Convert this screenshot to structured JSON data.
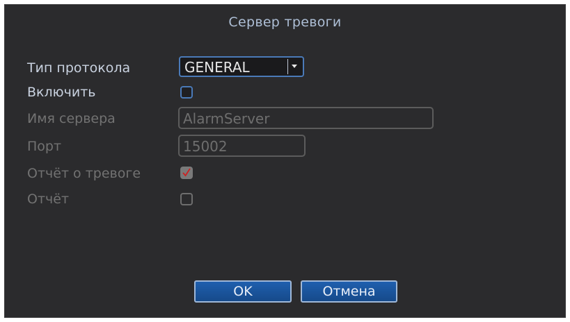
{
  "dialog": {
    "title": "Сервер тревоги"
  },
  "form": {
    "protocol_label": "Тип протокола",
    "protocol_value": "GENERAL",
    "enable_label": "Включить",
    "enable_checked": false,
    "server_name_label": "Имя сервера",
    "server_name_value": "AlarmServer",
    "port_label": "Порт",
    "port_value": "15002",
    "alarm_report_label": "Отчёт о тревоге",
    "alarm_report_checked": true,
    "report_label": "Отчёт",
    "report_checked": false
  },
  "buttons": {
    "ok_label": "OK",
    "cancel_label": "Отмена"
  },
  "colors": {
    "dialog_bg": "#2b2b2d",
    "title_text": "#aebfd6",
    "accent_border": "#4a7ab8",
    "button_bg": "#1f5fae",
    "check_mark": "#cc2222"
  },
  "icons": {
    "dropdown": "chevron-down-icon",
    "check": "checkmark-icon"
  }
}
